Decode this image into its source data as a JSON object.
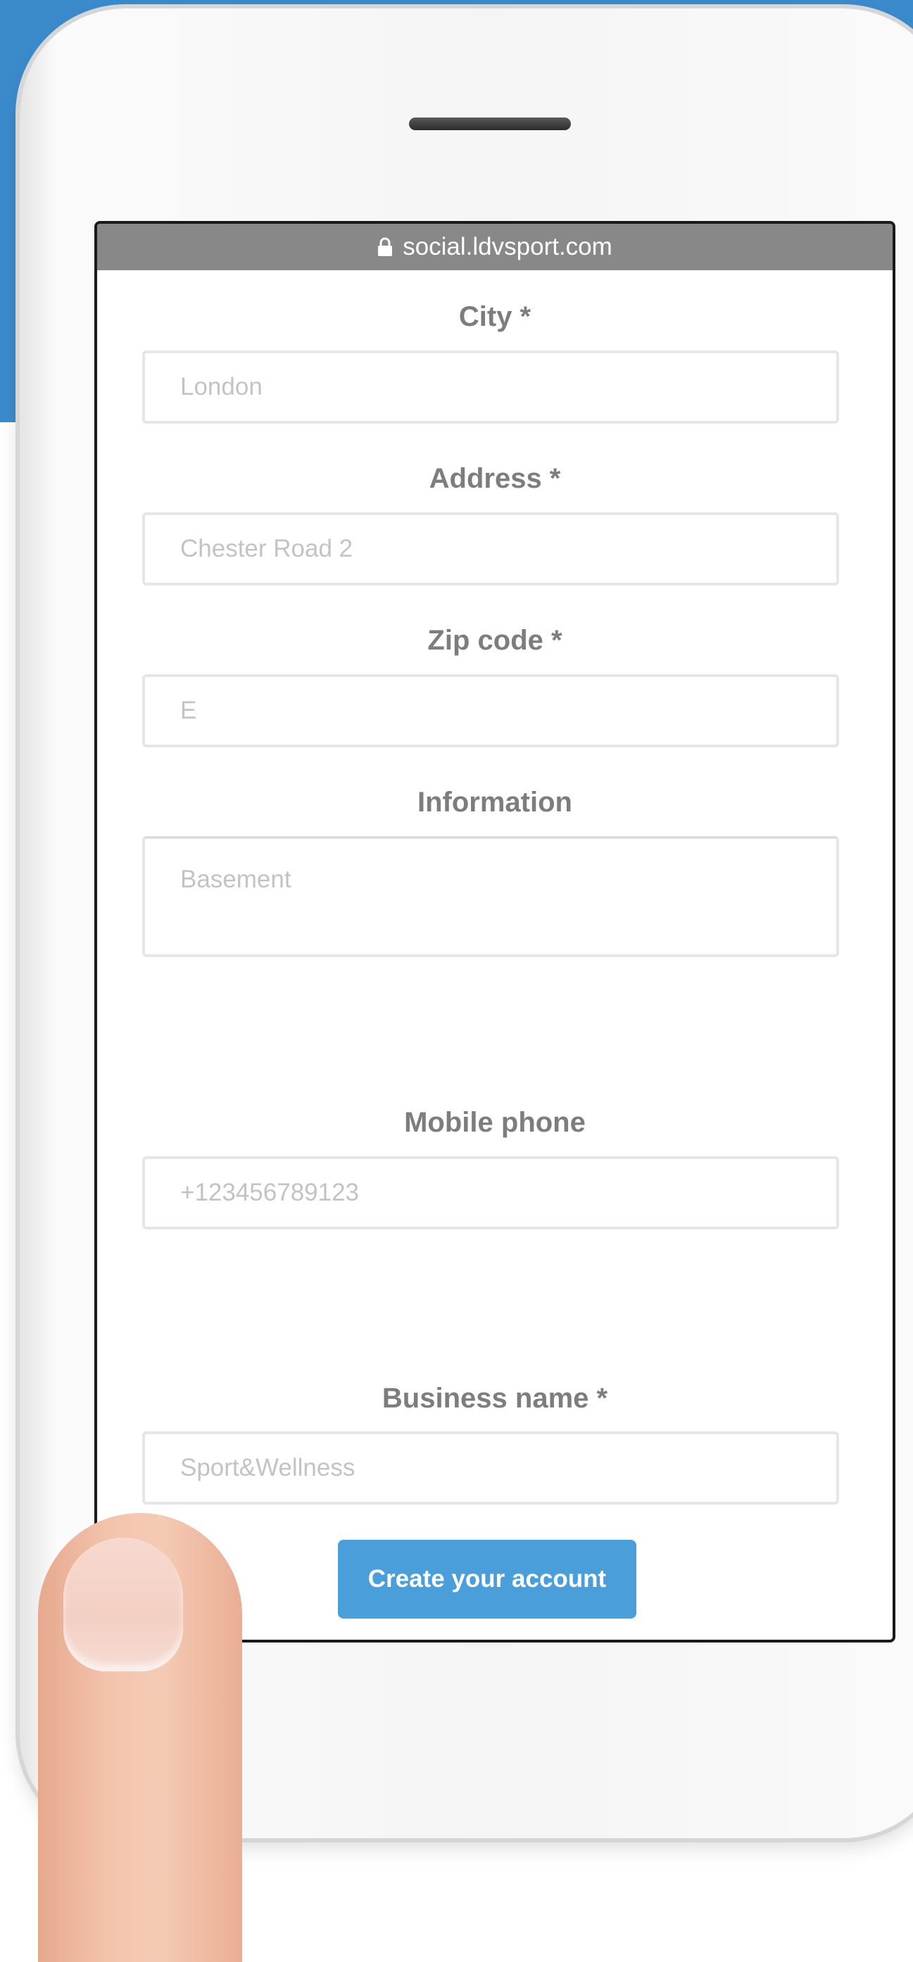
{
  "browser": {
    "url": "social.ldvsport.com",
    "lock_icon": "lock-icon"
  },
  "form": {
    "city": {
      "label": "City *",
      "placeholder": "London"
    },
    "address": {
      "label": "Address *",
      "placeholder": "Chester Road 2"
    },
    "zip": {
      "label": "Zip code *",
      "placeholder": "E"
    },
    "information": {
      "label": "Information",
      "placeholder": "Basement"
    },
    "mobile": {
      "label": "Mobile phone",
      "placeholder": "+123456789123"
    },
    "business": {
      "label": "Business name *",
      "placeholder": "Sport&Wellness"
    },
    "submit_label": "Create your account"
  },
  "colors": {
    "background_blue": "#3b8bcc",
    "button_blue": "#4a9ed9",
    "label_gray": "#7d7d7d",
    "url_bar_gray": "#888888"
  }
}
